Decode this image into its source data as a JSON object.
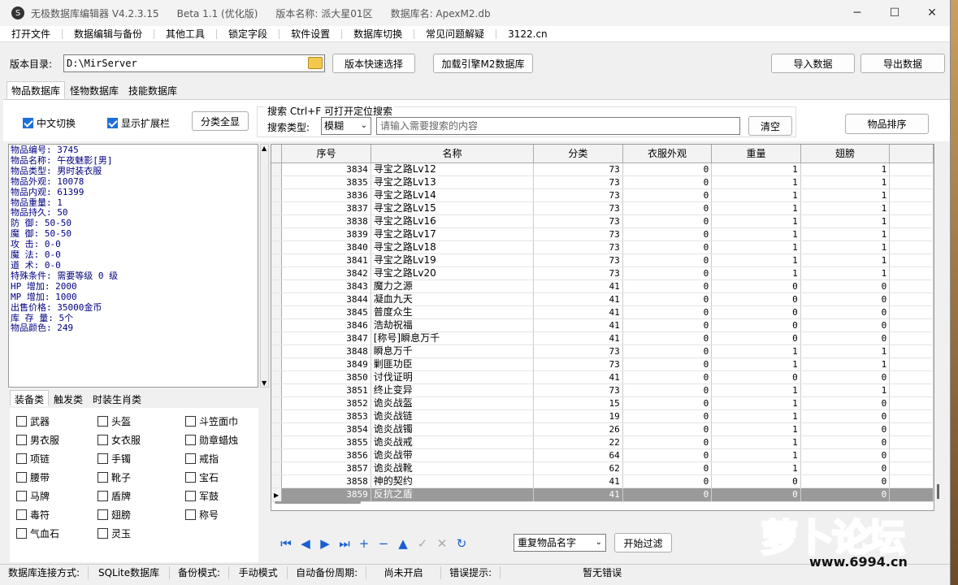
{
  "titlebar": {
    "app": "无极数据库编辑器 V4.2.3.15",
    "beta": "Beta 1.1 (优化版)",
    "version_name": "版本名称: 派大星01区",
    "db_name": "数据库名: ApexM2.db",
    "icon_glyph": "S"
  },
  "menu": [
    "打开文件",
    "数据编辑与备份",
    "其他工具",
    "锁定字段",
    "软件设置",
    "数据库切换",
    "常见问题解疑",
    "3122.cn"
  ],
  "toolbar": {
    "dir_label": "版本目录:",
    "dir_value": "D:\\MirServer",
    "quick_select": "版本快速选择",
    "load_m2": "加载引擎M2数据库",
    "import": "导入数据",
    "export": "导出数据"
  },
  "main_tabs": [
    "物品数据库",
    "怪物数据库",
    "技能数据库"
  ],
  "options": {
    "cn_switch": "中文切换",
    "show_ext": "显示扩展栏",
    "show_all": "分类全显",
    "search_title": "搜索   Ctrl+F 可打开定位搜索",
    "search_type_label": "搜索类型:",
    "search_type_value": "模糊",
    "search_placeholder": "请输入需要搜索的内容",
    "clear": "清空",
    "sort": "物品排序"
  },
  "info_lines": [
    "物品编号: 3745",
    "物品名称: 午夜魅影[男]",
    "物品类型: 男时装衣服",
    "物品外观: 10078",
    "物品内观: 61399",
    "物品重量: 1",
    "物品持久: 50",
    "防    御: 50-50",
    "魔    御: 50-50",
    "攻    击: 0-0",
    "魔    法: 0-0",
    "道    术: 0-0",
    "特殊条件: 需要等级 0 级",
    "HP  增加: 2000",
    "MP  增加: 1000",
    "出售价格: 35000金币",
    "库 存 量: 5个",
    "物品颜色: 249"
  ],
  "cat_tabs": [
    "装备类",
    "触发类",
    "时装生肖类"
  ],
  "categories": [
    [
      "武器",
      "头盔",
      "斗笠面巾"
    ],
    [
      "男衣服",
      "女衣服",
      "勋章蜡烛"
    ],
    [
      "项链",
      "手镯",
      "戒指"
    ],
    [
      "腰带",
      "靴子",
      "宝石"
    ],
    [
      "马牌",
      "盾牌",
      "军鼓"
    ],
    [
      "毒符",
      "翅膀",
      "称号"
    ],
    [
      "气血石",
      "灵玉",
      ""
    ]
  ],
  "grid": {
    "headers": [
      "序号",
      "名称",
      "分类",
      "衣服外观",
      "重量",
      "翅膀"
    ],
    "rows": [
      [
        "3834",
        "寻宝之路Lv12",
        "73",
        "0",
        "1",
        "1"
      ],
      [
        "3835",
        "寻宝之路Lv13",
        "73",
        "0",
        "1",
        "1"
      ],
      [
        "3836",
        "寻宝之路Lv14",
        "73",
        "0",
        "1",
        "1"
      ],
      [
        "3837",
        "寻宝之路Lv15",
        "73",
        "0",
        "1",
        "1"
      ],
      [
        "3838",
        "寻宝之路Lv16",
        "73",
        "0",
        "1",
        "1"
      ],
      [
        "3839",
        "寻宝之路Lv17",
        "73",
        "0",
        "1",
        "1"
      ],
      [
        "3840",
        "寻宝之路Lv18",
        "73",
        "0",
        "1",
        "1"
      ],
      [
        "3841",
        "寻宝之路Lv19",
        "73",
        "0",
        "1",
        "1"
      ],
      [
        "3842",
        "寻宝之路Lv20",
        "73",
        "0",
        "1",
        "1"
      ],
      [
        "3843",
        "魔力之源",
        "41",
        "0",
        "0",
        "0"
      ],
      [
        "3844",
        "凝血九天",
        "41",
        "0",
        "0",
        "0"
      ],
      [
        "3845",
        "普度众生",
        "41",
        "0",
        "0",
        "0"
      ],
      [
        "3846",
        "浩劫祝福",
        "41",
        "0",
        "0",
        "0"
      ],
      [
        "3847",
        "[称号]瞬息万千",
        "41",
        "0",
        "0",
        "0"
      ],
      [
        "3848",
        "瞬息万千",
        "73",
        "0",
        "1",
        "1"
      ],
      [
        "3849",
        "剿匪功臣",
        "73",
        "0",
        "1",
        "1"
      ],
      [
        "3850",
        "讨伐证明",
        "41",
        "0",
        "0",
        "0"
      ],
      [
        "3851",
        "终止变异",
        "73",
        "0",
        "1",
        "1"
      ],
      [
        "3852",
        "诡炎战盔",
        "15",
        "0",
        "1",
        "0"
      ],
      [
        "3853",
        "诡炎战链",
        "19",
        "0",
        "1",
        "0"
      ],
      [
        "3854",
        "诡炎战镯",
        "26",
        "0",
        "1",
        "0"
      ],
      [
        "3855",
        "诡炎战戒",
        "22",
        "0",
        "1",
        "0"
      ],
      [
        "3856",
        "诡炎战带",
        "64",
        "0",
        "1",
        "0"
      ],
      [
        "3857",
        "诡炎战靴",
        "62",
        "0",
        "1",
        "0"
      ],
      [
        "3858",
        "神的契约",
        "41",
        "0",
        "0",
        "0"
      ],
      [
        "3859",
        "反抗之盾",
        "41",
        "0",
        "0",
        "0"
      ]
    ],
    "selected_index": 25
  },
  "nav": {
    "icons": [
      "first-icon",
      "prior-icon",
      "next-icon",
      "last-icon",
      "insert-icon",
      "delete-icon",
      "edit-icon",
      "post-icon",
      "cancel-icon",
      "refresh-icon"
    ],
    "filter_select": "重复物品名字",
    "filter_button": "开始过滤"
  },
  "status": {
    "conn_label": "数据库连接方式:",
    "conn_value": "SQLite数据库",
    "backup_label": "备份模式:",
    "backup_value": "手动模式",
    "auto_label": "自动备份周期:",
    "auto_value": "尚未开启",
    "err_label": "错误提示:",
    "err_value": "暂无错误"
  },
  "logo": {
    "text": "萝卜论坛",
    "url": "www.6994.cn"
  },
  "colors": {
    "accent": "#1e6fd9",
    "info_text": "#000080",
    "selected_row": "#9a9a9a"
  }
}
